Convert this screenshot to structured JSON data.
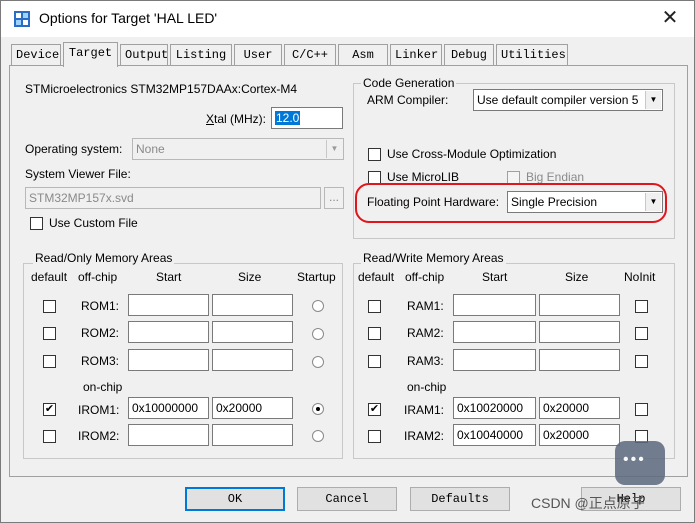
{
  "window": {
    "title": "Options for Target 'HAL LED'",
    "close_glyph": "✕"
  },
  "tabs": [
    {
      "label": "Device"
    },
    {
      "label": "Target"
    },
    {
      "label": "Output"
    },
    {
      "label": "Listing"
    },
    {
      "label": "User"
    },
    {
      "label": "C/C++"
    },
    {
      "label": "Asm"
    },
    {
      "label": "Linker"
    },
    {
      "label": "Debug"
    },
    {
      "label": "Utilities"
    }
  ],
  "active_tab": "Target",
  "device_name": "STMicroelectronics STM32MP157DAAx:Cortex-M4",
  "xtal": {
    "label_prefix": "X",
    "label_rest": "tal (MHz):",
    "value": "12.0"
  },
  "os": {
    "label": "Operating system:",
    "value": "None"
  },
  "svf": {
    "label": "System Viewer File:",
    "value": "STM32MP157x.svd",
    "browse": "..."
  },
  "custom_file": {
    "label": "Use Custom File",
    "checked": false
  },
  "code_gen": {
    "group_label": "Code Generation",
    "arm_compiler_label": "ARM Compiler:",
    "arm_compiler_value": "Use default compiler version 5",
    "cross_module_label": "Use Cross-Module Optimization",
    "microlib_label": "Use MicroLIB",
    "big_endian_label": "Big Endian",
    "fph_label": "Floating Point Hardware:",
    "fph_value": "Single Precision"
  },
  "ro_mem": {
    "group_label": "Read/Only Memory Areas",
    "headers": {
      "default": "default",
      "offchip": "off-chip",
      "start": "Start",
      "size": "Size",
      "startup": "Startup"
    },
    "onchip_label": "on-chip",
    "rows": [
      {
        "name": "ROM1:",
        "start": "",
        "size": "",
        "default": false,
        "startup": false
      },
      {
        "name": "ROM2:",
        "start": "",
        "size": "",
        "default": false,
        "startup": false
      },
      {
        "name": "ROM3:",
        "start": "",
        "size": "",
        "default": false,
        "startup": false
      },
      {
        "name": "IROM1:",
        "start": "0x10000000",
        "size": "0x20000",
        "default": true,
        "startup": true
      },
      {
        "name": "IROM2:",
        "start": "",
        "size": "",
        "default": false,
        "startup": false
      }
    ]
  },
  "rw_mem": {
    "group_label": "Read/Write Memory Areas",
    "headers": {
      "default": "default",
      "offchip": "off-chip",
      "start": "Start",
      "size": "Size",
      "noinit": "NoInit"
    },
    "onchip_label": "on-chip",
    "rows": [
      {
        "name": "RAM1:",
        "start": "",
        "size": "",
        "default": false
      },
      {
        "name": "RAM2:",
        "start": "",
        "size": "",
        "default": false
      },
      {
        "name": "RAM3:",
        "start": "",
        "size": "",
        "default": false
      },
      {
        "name": "IRAM1:",
        "start": "0x10020000",
        "size": "0x20000",
        "default": true
      },
      {
        "name": "IRAM2:",
        "start": "0x10040000",
        "size": "0x20000",
        "default": false
      }
    ]
  },
  "buttons": {
    "ok": "OK",
    "cancel": "Cancel",
    "defaults": "Defaults",
    "help": "Help"
  },
  "watermark": "CSDN @正点原子",
  "check_glyph": "✔",
  "arrow_glyph": "▼"
}
